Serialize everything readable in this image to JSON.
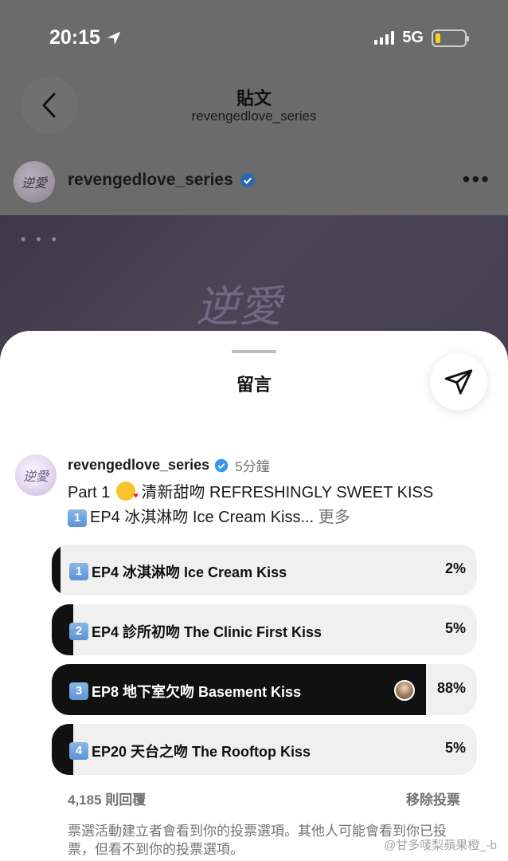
{
  "status": {
    "time": "20:15",
    "network": "5G"
  },
  "post": {
    "title": "貼文",
    "subtitle": "revengedlove_series",
    "author": "revengedlove_series",
    "avatar_text": "逆愛",
    "more": "•••",
    "image_dots": "• • •",
    "image_script": "逆愛"
  },
  "comments": {
    "title": "留言",
    "comment": {
      "avatar_text": "逆愛",
      "user": "revengedlove_series",
      "time": "5分鐘",
      "line1_prefix": "Part 1",
      "line1_text": "清新甜吻 REFRESHINGLY SWEET KISS",
      "line2_key": "1",
      "line2_text": "EP4 冰淇淋吻 Ice Cream Kiss...",
      "more_label": "更多"
    },
    "poll": {
      "options": [
        {
          "key": "1",
          "label": "EP4 冰淇淋吻 Ice Cream Kiss",
          "percent": "2%",
          "value": 2
        },
        {
          "key": "2",
          "label": "EP4 診所初吻 The Clinic First Kiss",
          "percent": "5%",
          "value": 5
        },
        {
          "key": "3",
          "label": "EP8 地下室欠吻 Basement Kiss",
          "percent": "88%",
          "value": 88,
          "selected": true
        },
        {
          "key": "4",
          "label": "EP20 天台之吻 The Rooftop Kiss",
          "percent": "5%",
          "value": 5
        }
      ],
      "vote_count": "4,185 則回覆",
      "remove_vote": "移除投票",
      "notice": "票選活動建立者會看到你的投票選項。其他人可能會看到你已投票，但看不到你的投票選項。"
    }
  },
  "watermark": "@甘多唛梨蘋果橙_-b",
  "colors": {
    "poll_selected": "#111111",
    "poll_bg": "#f0f0f0",
    "verified": "#3897f0",
    "keycap": "#5d92d4"
  }
}
